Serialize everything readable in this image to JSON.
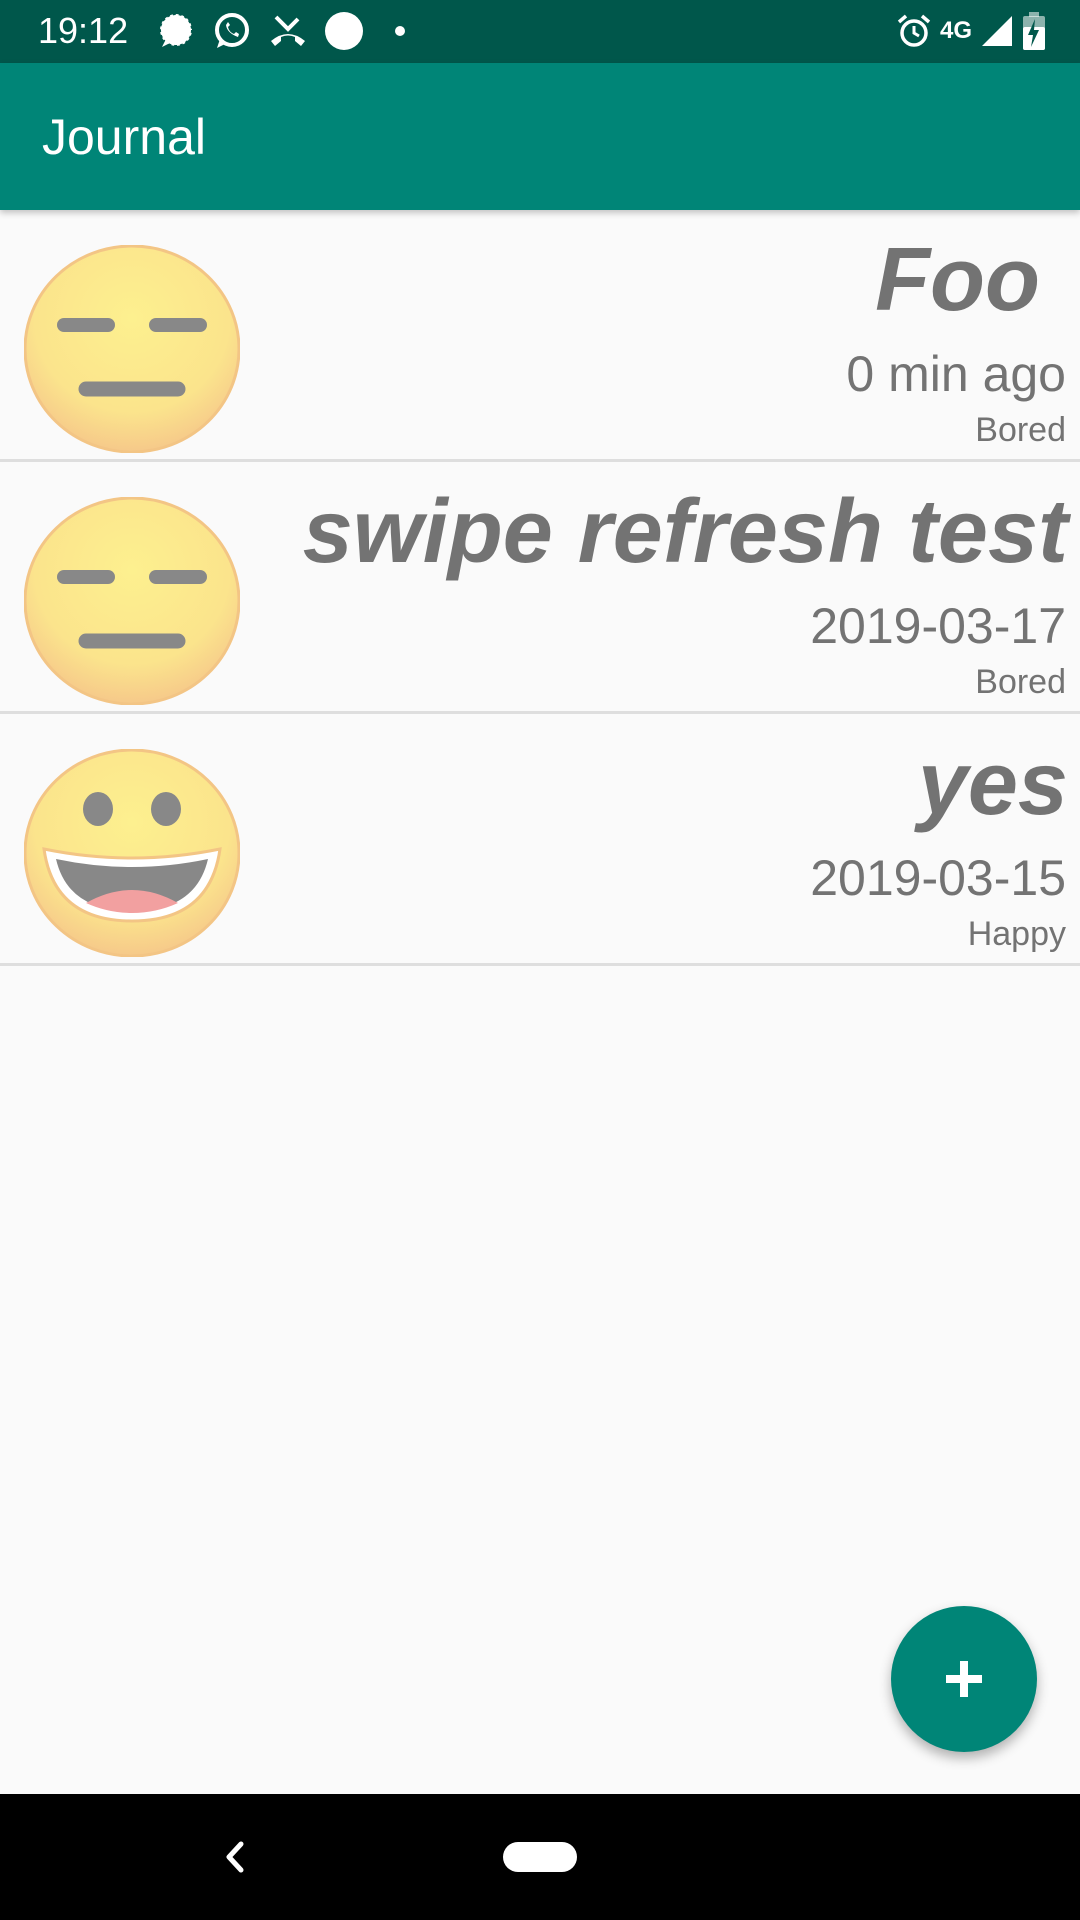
{
  "status_bar": {
    "time": "19:12",
    "network": "4G",
    "icons": [
      "chat-bubble-icon",
      "whatsapp-icon",
      "missed-call-icon",
      "circle-icon",
      "dot-icon",
      "alarm-icon",
      "signal-icon",
      "battery-icon"
    ]
  },
  "app_bar": {
    "title": "Journal"
  },
  "entries": [
    {
      "title": "Foo",
      "date": "0 min ago",
      "mood": "Bored",
      "icon": "bored-face-icon"
    },
    {
      "title": "swipe refresh test",
      "date": "2019-03-17",
      "mood": "Bored",
      "icon": "bored-face-icon"
    },
    {
      "title": "yes",
      "date": "2019-03-15",
      "mood": "Happy",
      "icon": "happy-face-icon"
    }
  ],
  "fab": {
    "icon": "plus-icon"
  },
  "navigation_bar": {
    "icons": [
      "back-icon",
      "home-pill-icon"
    ]
  },
  "colors": {
    "status_bar": "#00574b",
    "app_bar": "#008577",
    "accent": "#008577",
    "background": "#fafafa",
    "text": "#737373"
  }
}
